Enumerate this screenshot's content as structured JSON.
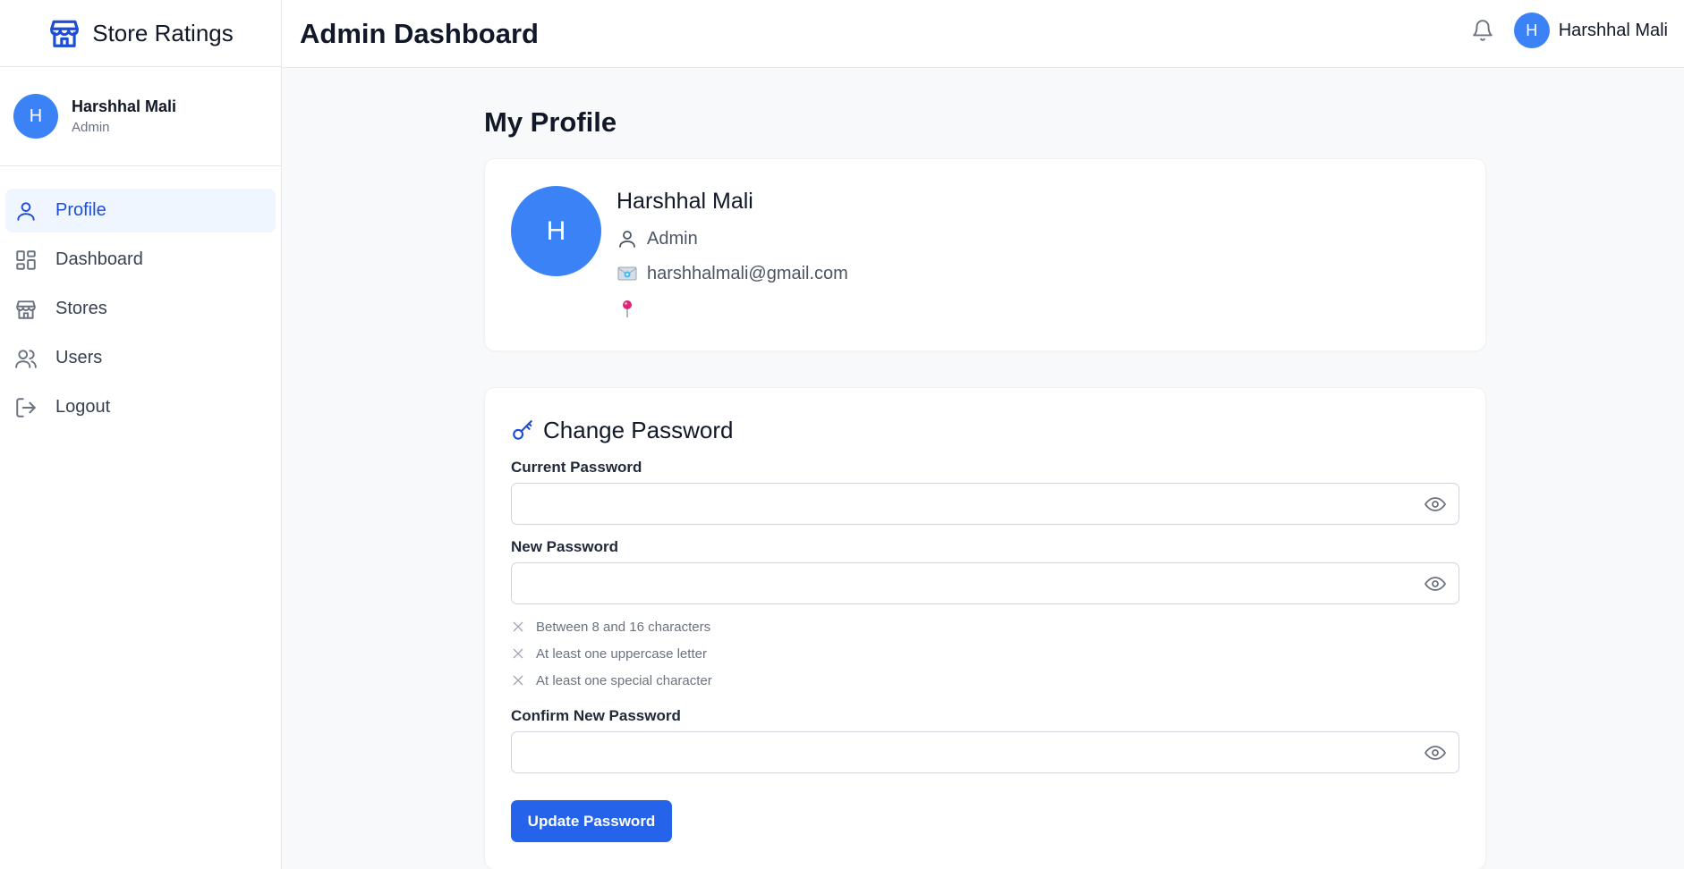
{
  "brand": {
    "name": "Store Ratings",
    "icon": "store-icon",
    "color": "#1d4ed8"
  },
  "sidebar_user": {
    "initial": "H",
    "name": "Harshhal Mali",
    "role": "Admin"
  },
  "nav": [
    {
      "label": "Profile",
      "icon": "user-icon",
      "active": true
    },
    {
      "label": "Dashboard",
      "icon": "dashboard-icon",
      "active": false
    },
    {
      "label": "Stores",
      "icon": "store-icon",
      "active": false
    },
    {
      "label": "Users",
      "icon": "users-icon",
      "active": false
    },
    {
      "label": "Logout",
      "icon": "logout-icon",
      "active": false
    }
  ],
  "header": {
    "title": "Admin Dashboard",
    "user_initial": "H",
    "user_name": "Harshhal Mali"
  },
  "profile": {
    "page_title": "My Profile",
    "initial": "H",
    "name": "Harshhal Mali",
    "role": "Admin",
    "email": "harshhalmali@gmail.com"
  },
  "password": {
    "title": "Change Password",
    "current_label": "Current Password",
    "new_label": "New Password",
    "confirm_label": "Confirm New Password",
    "requirements": [
      "Between 8 and 16 characters",
      "At least one uppercase letter",
      "At least one special character"
    ],
    "submit_label": "Update Password"
  },
  "colors": {
    "accent": "#3b82f6",
    "button": "#2563eb",
    "active_nav_bg": "#eff6ff"
  }
}
